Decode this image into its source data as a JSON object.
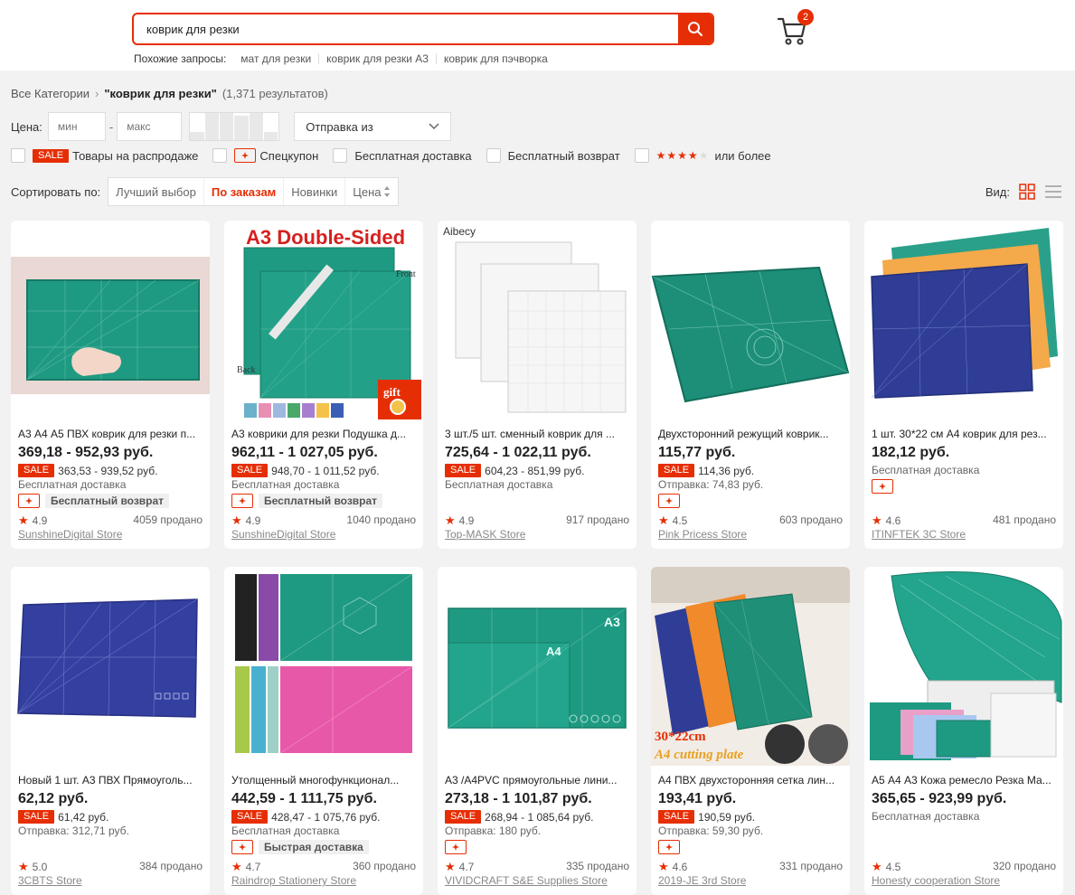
{
  "search": {
    "value": "коврик для резки"
  },
  "related": {
    "label": "Похожие запросы:",
    "items": [
      "мат для резки",
      "коврик для резки А3",
      "коврик для пэчворка"
    ]
  },
  "cart": {
    "count": "2"
  },
  "breadcrumb": {
    "root": "Все Категории",
    "query": "\"коврик для резки\"",
    "count": "(1,371 результатов)"
  },
  "filters": {
    "price_label": "Цена:",
    "min_placeholder": "мин",
    "max_placeholder": "макс",
    "ship_from": "Отправка из",
    "sale_tag": "SALE",
    "sale_label": "Товары на распродаже",
    "coupon_label": "Спецкупон",
    "free_shipping": "Бесплатная доставка",
    "free_return": "Бесплатный возврат",
    "rating_label": "или более"
  },
  "sort": {
    "label": "Сортировать по:",
    "options": [
      "Лучший выбор",
      "По заказам",
      "Новинки",
      "Цена"
    ],
    "active": "По заказам"
  },
  "view": {
    "label": "Вид:"
  },
  "colors": {
    "accent": "#e62e04",
    "teal": "#1f9a82",
    "navy": "#2e3a8c"
  },
  "products": [
    {
      "title": "А3 А4 А5 ПВХ коврик для резки п...",
      "price": "369,18 - 952,93 руб.",
      "sale": "363,53 - 939,52 руб.",
      "ship": "Бесплатная доставка",
      "badge": "Бесплатный возврат",
      "rating": "4.9",
      "sold": "4059 продано",
      "store": "SunshineDigital Store"
    },
    {
      "title": "А3 коврики для резки Подушка д...",
      "price": "962,11 - 1 027,05 руб.",
      "sale": "948,70 - 1 011,52 руб.",
      "ship": "Бесплатная доставка",
      "badge": "Бесплатный возврат",
      "rating": "4.9",
      "sold": "1040 продано",
      "store": "SunshineDigital Store",
      "img_text": "A3 Double-Sided",
      "img_front": "Front",
      "img_back": "Back",
      "img_gift": "gift"
    },
    {
      "title": "3 шт./5 шт. сменный коврик для ...",
      "price": "725,64 - 1 022,11 руб.",
      "sale": "604,23 - 851,99 руб.",
      "ship": "Бесплатная доставка",
      "badge": "",
      "rating": "4.9",
      "sold": "917 продано",
      "store": "Top-MASK Store",
      "img_text": "Aibecy"
    },
    {
      "title": "Двухсторонний режущий коврик...",
      "price": "115,77 руб.",
      "sale": "114,36 руб.",
      "ship": "Отправка: 74,83 руб.",
      "badge": "",
      "rating": "4.5",
      "sold": "603 продано",
      "store": "Pink Pricess Store"
    },
    {
      "title": "1 шт. 30*22 см А4 коврик для рез...",
      "price": "182,12 руб.",
      "sale": "",
      "ship": "Бесплатная доставка",
      "badge": "",
      "rating": "4.6",
      "sold": "481 продано",
      "store": "ITINFTEK 3C Store"
    },
    {
      "title": "Новый 1 шт. А3 ПВХ Прямоуголь...",
      "price": "62,12 руб.",
      "sale": "61,42 руб.",
      "ship": "Отправка: 312,71 руб.",
      "badge": "",
      "rating": "5.0",
      "sold": "384 продано",
      "store": "3CBTS Store"
    },
    {
      "title": "Утолщенный многофункционал...",
      "price": "442,59 - 1 111,75 руб.",
      "sale": "428,47 - 1 075,76 руб.",
      "ship": "Бесплатная доставка",
      "badge": "Быстрая доставка",
      "rating": "4.7",
      "sold": "360 продано",
      "store": "Raindrop Stationery Store"
    },
    {
      "title": "А3 /А4PVC прямоугольные лини...",
      "price": "273,18 - 1 101,87 руб.",
      "sale": "268,94 - 1 085,64 руб.",
      "ship": "Отправка: 180 руб.",
      "badge": "",
      "rating": "4.7",
      "sold": "335 продано",
      "store": "VIVIDCRAFT S&E Supplies Store",
      "img_a3": "A3",
      "img_a4": "A4"
    },
    {
      "title": "А4 ПВХ двухсторонняя сетка лин...",
      "price": "193,41 руб.",
      "sale": "190,59 руб.",
      "ship": "Отправка: 59,30 руб.",
      "badge": "",
      "rating": "4.6",
      "sold": "331 продано",
      "store": "2019-JE 3rd Store",
      "img_text": "30*22cm",
      "img_text2": "A4 cutting plate"
    },
    {
      "title": "А5 А4 А3 Кожа ремесло Резка Ма...",
      "price": "365,65 - 923,99 руб.",
      "sale": "",
      "ship": "Бесплатная доставка",
      "badge": "",
      "rating": "4.5",
      "sold": "320 продано",
      "store": "Honesty cooperation Store"
    }
  ]
}
